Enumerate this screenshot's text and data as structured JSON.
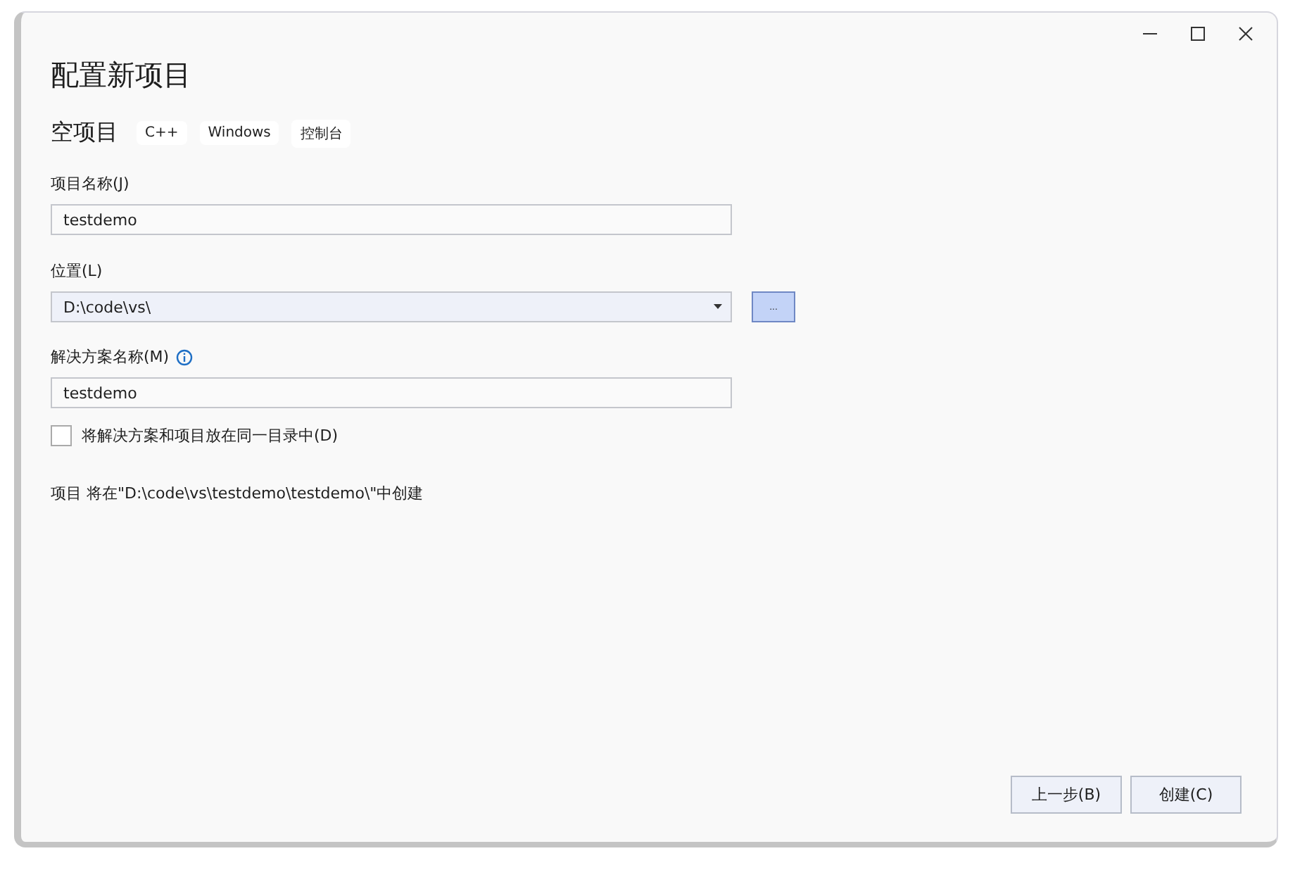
{
  "window": {
    "title": "配置新项目"
  },
  "template": {
    "name": "空项目",
    "tags": [
      "C++",
      "Windows",
      "控制台"
    ]
  },
  "project_name": {
    "label": "项目名称(J)",
    "value": "testdemo"
  },
  "location": {
    "label": "位置(L)",
    "value": "D:\\code\\vs\\",
    "browse": "..."
  },
  "solution_name": {
    "label": "解决方案名称(M)",
    "value": "testdemo"
  },
  "same_directory": {
    "label": "将解决方案和项目放在同一目录中(D)",
    "checked": false
  },
  "info": "项目 将在\"D:\\code\\vs\\testdemo\\testdemo\\\"中创建",
  "buttons": [
    "上一步(B)",
    "创建(C)"
  ]
}
